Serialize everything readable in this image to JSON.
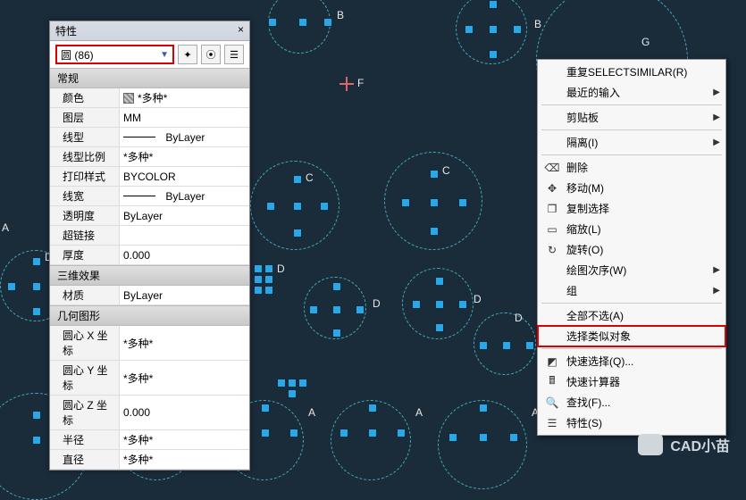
{
  "panel": {
    "title": "特性",
    "combo": "圆 (86)",
    "sections": {
      "general": "常规",
      "threed": "三维效果",
      "geom": "几何图形"
    },
    "rows": {
      "color_k": "颜色",
      "color_v": "*多种*",
      "layer_k": "图层",
      "layer_v": "MM",
      "ltype_k": "线型",
      "ltype_v": "ByLayer",
      "ltscale_k": "线型比例",
      "ltscale_v": "*多种*",
      "pstyle_k": "打印样式",
      "pstyle_v": "BYCOLOR",
      "lweight_k": "线宽",
      "lweight_v": "ByLayer",
      "trans_k": "透明度",
      "trans_v": "ByLayer",
      "hlink_k": "超链接",
      "hlink_v": "",
      "thick_k": "厚度",
      "thick_v": "0.000",
      "mat_k": "材质",
      "mat_v": "ByLayer",
      "cx_k": "圆心 X 坐标",
      "cx_v": "*多种*",
      "cy_k": "圆心 Y 坐标",
      "cy_v": "*多种*",
      "cz_k": "圆心 Z 坐标",
      "cz_v": "0.000",
      "rad_k": "半径",
      "rad_v": "*多种*",
      "dia_k": "直径",
      "dia_v": "*多种*"
    }
  },
  "menu": {
    "repeat": "重复SELECTSIMILAR(R)",
    "recent": "最近的输入",
    "clipboard": "剪贴板",
    "isolate": "隔离(I)",
    "delete": "删除",
    "move": "移动(M)",
    "copysel": "复制选择",
    "scale": "缩放(L)",
    "rotate": "旋转(O)",
    "draworder": "绘图次序(W)",
    "group": "组",
    "deselect": "全部不选(A)",
    "selectsimilar": "选择类似对象",
    "qselect": "快速选择(Q)...",
    "qcalc": "快速计算器",
    "find": "查找(F)...",
    "props": "特性(S)"
  },
  "canvas": {
    "A": "A",
    "B": "B",
    "C": "C",
    "D": "D",
    "F": "F",
    "G": "G"
  },
  "watermark": "CAD小苗"
}
